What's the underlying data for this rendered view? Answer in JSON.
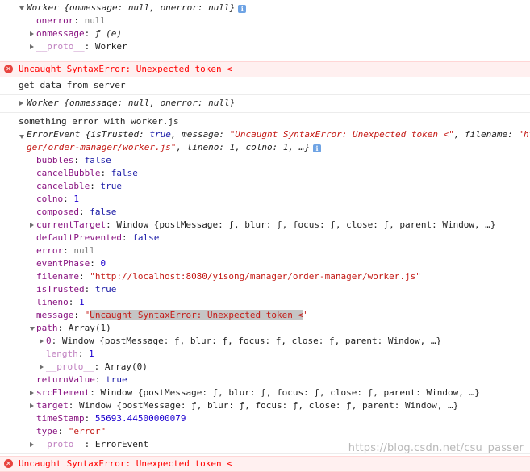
{
  "worker_obj": {
    "summary": "Worker {onmessage: null, onerror: null}",
    "info_icon": "i",
    "onerror_key": "onerror",
    "onerror_val": "null",
    "onmessage_key": "onmessage",
    "onmessage_val": "ƒ (e)",
    "proto_key": "__proto__",
    "proto_val": "Worker"
  },
  "error1": "Uncaught SyntaxError: Unexpected token <",
  "log_get_data": "get data from server",
  "worker_summary2": "Worker {onmessage: null, onerror: null}",
  "log_error": "something error with worker.js",
  "error_event": {
    "line1_prefix": "ErrorEvent {isTrusted: ",
    "line1_true": "true",
    "line1_msg_key": ", message: ",
    "line1_msg_val": "\"Uncaught SyntaxError: Unexpected token <\"",
    "line1_filename_key": ", filename: ",
    "line1_filename_val": "\"ht",
    "line2_str": "ger/order-manager/worker.js\"",
    "line2_rest": ", lineno: 1, colno: 1, …}",
    "props": [
      {
        "key": "bubbles",
        "val": "false",
        "type": "bool"
      },
      {
        "key": "cancelBubble",
        "val": "false",
        "type": "bool"
      },
      {
        "key": "cancelable",
        "val": "true",
        "type": "bool"
      },
      {
        "key": "colno",
        "val": "1",
        "type": "num"
      },
      {
        "key": "composed",
        "val": "false",
        "type": "bool"
      }
    ],
    "currentTarget_key": "currentTarget",
    "currentTarget_val": "Window {postMessage: ƒ, blur: ƒ, focus: ƒ, close: ƒ, parent: Window, …}",
    "props2": [
      {
        "key": "defaultPrevented",
        "val": "false",
        "type": "bool"
      },
      {
        "key": "error",
        "val": "null",
        "type": "null"
      },
      {
        "key": "eventPhase",
        "val": "0",
        "type": "num"
      },
      {
        "key": "filename",
        "val": "\"http://localhost:8080/yisong/manager/order-manager/worker.js\"",
        "type": "str"
      },
      {
        "key": "isTrusted",
        "val": "true",
        "type": "bool"
      },
      {
        "key": "lineno",
        "val": "1",
        "type": "num"
      }
    ],
    "message_key": "message",
    "message_q1": "\"",
    "message_hl": "Uncaught SyntaxError: Unexpected token <",
    "message_q2": "\"",
    "path_key": "path",
    "path_val": "Array(1)",
    "path0_key": "0",
    "path0_val": "Window {postMessage: ƒ, blur: ƒ, focus: ƒ, close: ƒ, parent: Window, …}",
    "length_key": "length",
    "length_val": "1",
    "path_proto_key": "__proto__",
    "path_proto_val": "Array(0)",
    "returnValue_key": "returnValue",
    "returnValue_val": "true",
    "srcElement_key": "srcElement",
    "srcElement_val": "Window {postMessage: ƒ, blur: ƒ, focus: ƒ, close: ƒ, parent: Window, …}",
    "target_key": "target",
    "target_val": "Window {postMessage: ƒ, blur: ƒ, focus: ƒ, close: ƒ, parent: Window, …}",
    "timeStamp_key": "timeStamp",
    "timeStamp_val": "55693.44500000079",
    "type_key": "type",
    "type_val": "\"error\"",
    "proto_key": "__proto__",
    "proto_val": "ErrorEvent"
  },
  "error2": "Uncaught SyntaxError: Unexpected token <",
  "watermark": "https://blog.csdn.net/csu_passer",
  "icons": {
    "error": "error-circle-icon",
    "info": "info-icon",
    "expand": "triangle-icon"
  },
  "colors": {
    "key": "#881280",
    "string": "#c41a16",
    "bool": "#1a1aa6",
    "number": "#1c00cf",
    "error_bg": "#fff0f0",
    "error_text": "#ff0000"
  }
}
